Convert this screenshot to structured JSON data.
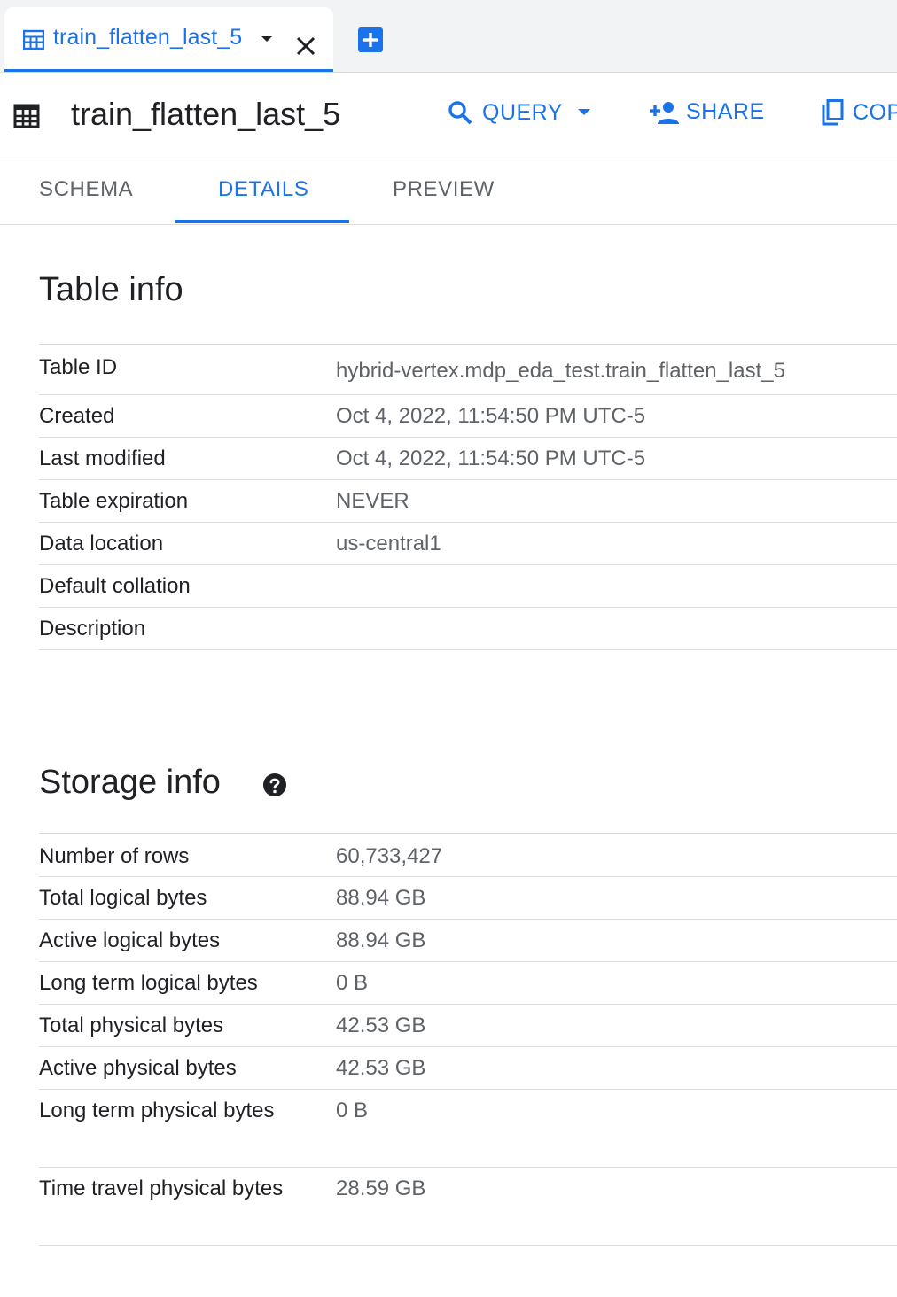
{
  "editor_tab": {
    "title": "train_flatten_last_5"
  },
  "header": {
    "title": "train_flatten_last_5",
    "actions": {
      "query": "QUERY",
      "share": "SHARE",
      "copy": "COP"
    }
  },
  "tabs": [
    "SCHEMA",
    "DETAILS",
    "PREVIEW"
  ],
  "active_tab": "DETAILS",
  "table_info": {
    "heading": "Table info",
    "rows": [
      {
        "label": "Table ID",
        "value": "hybrid-vertex.mdp_eda_test.train_flatten_last_5"
      },
      {
        "label": "Created",
        "value": "Oct 4, 2022, 11:54:50 PM UTC-5"
      },
      {
        "label": "Last modified",
        "value": "Oct 4, 2022, 11:54:50 PM UTC-5"
      },
      {
        "label": "Table expiration",
        "value": "NEVER"
      },
      {
        "label": "Data location",
        "value": "us-central1"
      },
      {
        "label": "Default collation",
        "value": ""
      },
      {
        "label": "Description",
        "value": ""
      }
    ]
  },
  "storage_info": {
    "heading": "Storage info",
    "rows": [
      {
        "label": "Number of rows",
        "value": "60,733,427"
      },
      {
        "label": "Total logical bytes",
        "value": "88.94 GB"
      },
      {
        "label": "Active logical bytes",
        "value": "88.94 GB"
      },
      {
        "label": "Long term logical bytes",
        "value": "0 B"
      },
      {
        "label": "Total physical bytes",
        "value": "42.53 GB"
      },
      {
        "label": "Active physical bytes",
        "value": "42.53 GB"
      },
      {
        "label": "Long term physical bytes",
        "value": "0 B"
      },
      {
        "label": "Time travel physical bytes",
        "value": "28.59 GB"
      }
    ]
  },
  "colors": {
    "accent": "#1a73e8",
    "text": "#202124",
    "secondary_text": "#5f6368",
    "divider": "#dadce0"
  }
}
